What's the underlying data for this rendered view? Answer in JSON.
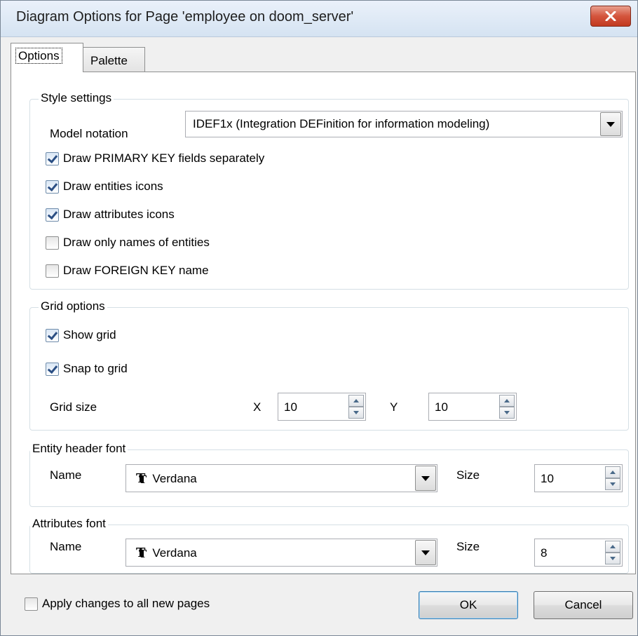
{
  "window": {
    "title": "Diagram Options for Page 'employee on doom_server'"
  },
  "tabs": [
    {
      "label": "Options",
      "active": true
    },
    {
      "label": "Palette",
      "active": false
    }
  ],
  "style_settings": {
    "legend": "Style settings",
    "model_notation_label": "Model notation",
    "model_notation_value": "IDEF1x (Integration DEFinition for information modeling)",
    "checkboxes": [
      {
        "label": "Draw PRIMARY KEY fields separately",
        "checked": true
      },
      {
        "label": "Draw entities icons",
        "checked": true
      },
      {
        "label": "Draw attributes icons",
        "checked": true
      },
      {
        "label": "Draw only names of entities",
        "checked": false
      },
      {
        "label": "Draw FOREIGN KEY name",
        "checked": false
      }
    ]
  },
  "grid_options": {
    "legend": "Grid options",
    "show_grid": {
      "label": "Show grid",
      "checked": true
    },
    "snap_to_grid": {
      "label": "Snap to grid",
      "checked": true
    },
    "grid_size_label": "Grid size",
    "x_label": "X",
    "x_value": "10",
    "y_label": "Y",
    "y_value": "10"
  },
  "entity_header_font": {
    "legend": "Entity header font",
    "name_label": "Name",
    "name_value": "Verdana",
    "size_label": "Size",
    "size_value": "10"
  },
  "attributes_font": {
    "legend": "Attributes font",
    "name_label": "Name",
    "name_value": "Verdana",
    "size_label": "Size",
    "size_value": "8"
  },
  "footer": {
    "apply_all": {
      "label": "Apply changes to all new pages",
      "checked": false
    },
    "ok_label": "OK",
    "cancel_label": "Cancel"
  },
  "icons": [
    "close-icon",
    "chevron-down-icon",
    "spin-up-icon",
    "spin-down-icon",
    "font-icon",
    "checkmark-icon"
  ],
  "colors": {
    "close_button": "#c8472c",
    "title_bar": "#dbe7f4",
    "panel_bg": "#ffffff",
    "dialog_bg": "#f0f0f0"
  }
}
